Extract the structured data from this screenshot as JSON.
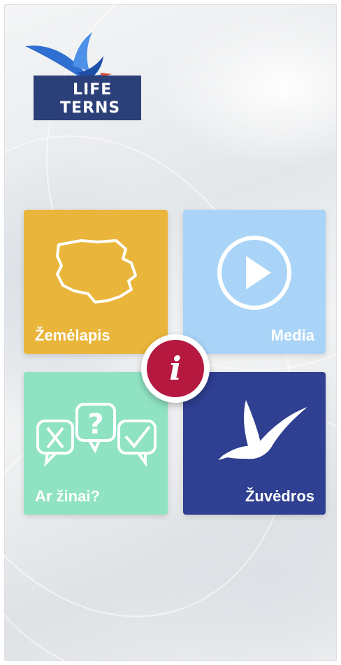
{
  "app": {
    "logo_line1": "LIFE",
    "logo_line2": "TERNS"
  },
  "tiles": [
    {
      "label": "Žemėlapis",
      "color": "#e9b53a",
      "icon": "lithuania-map-icon"
    },
    {
      "label": "Media",
      "color": "#a9d4f7",
      "icon": "play-icon"
    },
    {
      "label": "Ar žinai?",
      "color": "#8fe3c3",
      "icon": "quiz-bubbles-icon"
    },
    {
      "label": "Žuvėdros",
      "color": "#2f3f91",
      "icon": "tern-bird-icon"
    }
  ],
  "info_button": {
    "label": "i",
    "color": "#b5193f",
    "icon": "info-icon"
  }
}
